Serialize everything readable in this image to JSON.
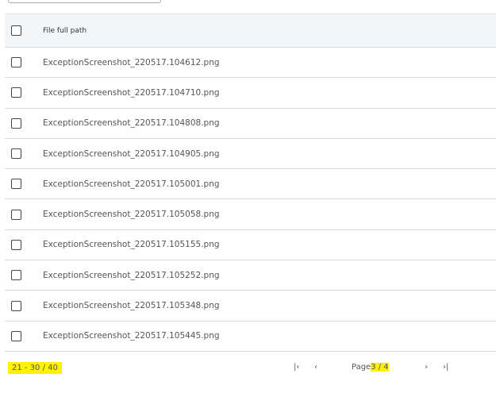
{
  "table": {
    "header": "File full path",
    "rows": [
      "ExceptionScreenshot_220517.104612.png",
      "ExceptionScreenshot_220517.104710.png",
      "ExceptionScreenshot_220517.104808.png",
      "ExceptionScreenshot_220517.104905.png",
      "ExceptionScreenshot_220517.105001.png",
      "ExceptionScreenshot_220517.105058.png",
      "ExceptionScreenshot_220517.105155.png",
      "ExceptionScreenshot_220517.105252.png",
      "ExceptionScreenshot_220517.105348.png",
      "ExceptionScreenshot_220517.105445.png"
    ]
  },
  "pagination": {
    "range": "21 - 30 / 40",
    "page_label": "Page",
    "page_value": "3 / 4",
    "first_icon": "first-page-icon",
    "prev_icon": "prev-page-icon",
    "next_icon": "next-page-icon",
    "last_icon": "last-page-icon"
  },
  "colors": {
    "highlight": "#fff200",
    "header_bg": "#f2f6f8"
  }
}
